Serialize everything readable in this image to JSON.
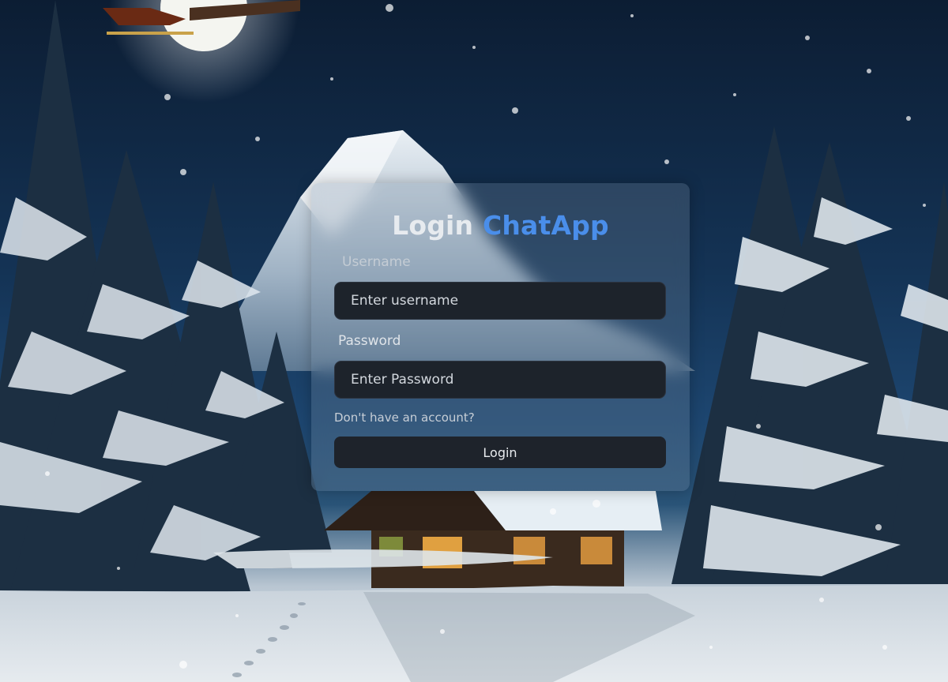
{
  "login": {
    "title_prefix": "Login",
    "title_brand": "ChatApp",
    "username_label": "Username",
    "username_placeholder": "Enter username",
    "password_label": "Password",
    "password_placeholder": "Enter Password",
    "signup_link": "Don't have an account?",
    "submit_label": "Login"
  },
  "colors": {
    "brand_blue": "#4a8eea",
    "input_bg": "#1d232b",
    "button_bg": "#1e232b"
  }
}
